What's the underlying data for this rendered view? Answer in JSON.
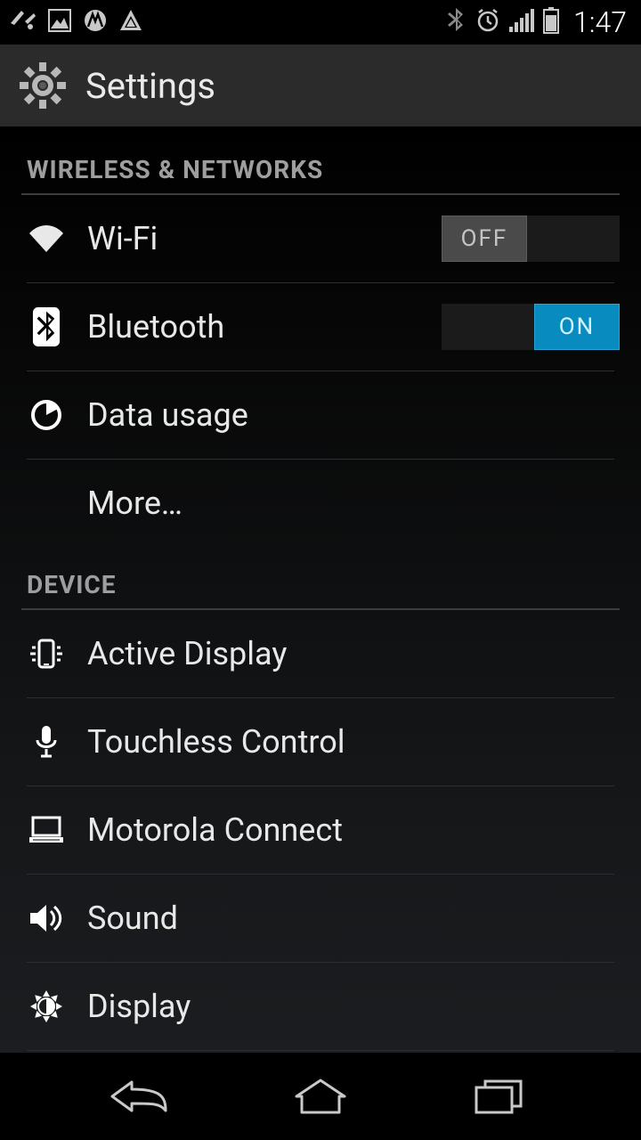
{
  "status": {
    "clock": "1:47"
  },
  "app": {
    "title": "Settings"
  },
  "sections": {
    "wireless": {
      "header": "WIRELESS & NETWORKS",
      "wifi": {
        "label": "Wi-Fi",
        "toggle": "OFF"
      },
      "bluetooth": {
        "label": "Bluetooth",
        "toggle": "ON"
      },
      "data_usage": {
        "label": "Data usage"
      },
      "more": {
        "label": "More…"
      }
    },
    "device": {
      "header": "DEVICE",
      "active_display": {
        "label": "Active Display"
      },
      "touchless": {
        "label": "Touchless Control"
      },
      "moto_connect": {
        "label": "Motorola Connect"
      },
      "sound": {
        "label": "Sound"
      },
      "display": {
        "label": "Display"
      }
    }
  }
}
